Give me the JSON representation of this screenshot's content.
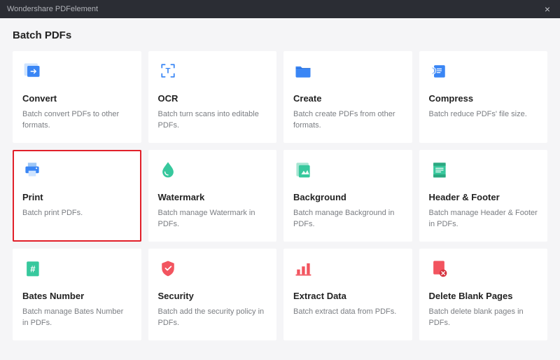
{
  "titlebar": {
    "app_name": "Wondershare PDFelement",
    "close_label": "×"
  },
  "page": {
    "heading": "Batch PDFs"
  },
  "cards": {
    "convert": {
      "title": "Convert",
      "desc": "Batch convert PDFs to other formats."
    },
    "ocr": {
      "title": "OCR",
      "desc": "Batch turn scans into editable PDFs."
    },
    "create": {
      "title": "Create",
      "desc": "Batch create PDFs from other formats."
    },
    "compress": {
      "title": "Compress",
      "desc": "Batch reduce PDFs' file size."
    },
    "print": {
      "title": "Print",
      "desc": "Batch print PDFs."
    },
    "watermark": {
      "title": "Watermark",
      "desc": "Batch manage Watermark in PDFs."
    },
    "background": {
      "title": "Background",
      "desc": "Batch manage Background in PDFs."
    },
    "header": {
      "title": "Header & Footer",
      "desc": "Batch manage Header & Footer in PDFs."
    },
    "bates": {
      "title": "Bates Number",
      "desc": "Batch manage Bates Number in PDFs."
    },
    "security": {
      "title": "Security",
      "desc": "Batch add the security policy in PDFs."
    },
    "extract": {
      "title": "Extract Data",
      "desc": "Batch extract data from PDFs."
    },
    "delete": {
      "title": "Delete Blank Pages",
      "desc": "Batch delete blank pages in PDFs."
    }
  },
  "highlighted_card": "print"
}
